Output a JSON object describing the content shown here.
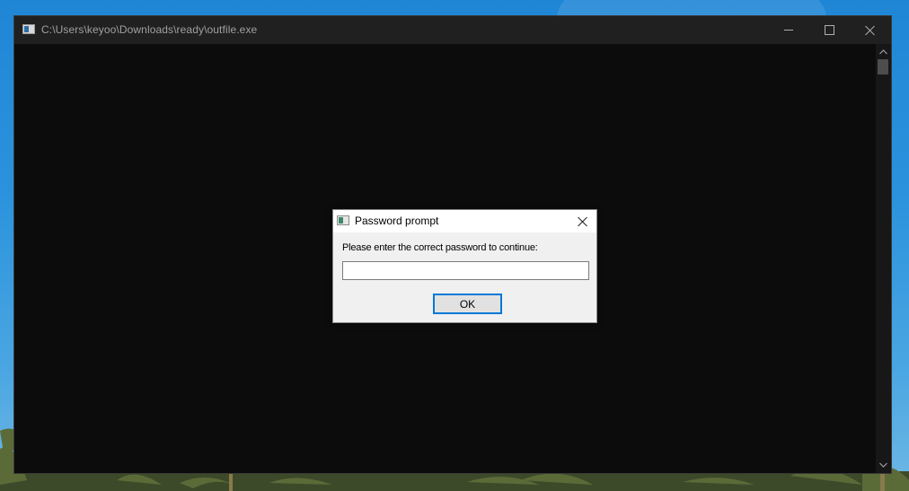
{
  "console_window": {
    "title": "C:\\Users\\keyoo\\Downloads\\ready\\outfile.exe",
    "icon": "console-app-icon"
  },
  "window_controls": {
    "minimize_icon": "minimize-icon",
    "maximize_icon": "maximize-icon",
    "close_icon": "close-icon"
  },
  "dialog": {
    "title": "Password prompt",
    "icon": "app-icon",
    "prompt": "Please enter the correct password to continue:",
    "input_value": "",
    "ok_label": "OK",
    "close_icon": "close-icon"
  },
  "colors": {
    "console_background": "#0c0c0c",
    "titlebar": "#202020",
    "dialog_background": "#f0f0f0",
    "button_focus_border": "#0078d7",
    "desktop_sky": "#2b93dd"
  }
}
